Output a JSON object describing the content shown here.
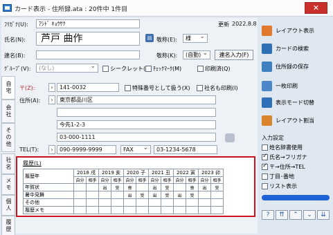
{
  "window": {
    "title": "カード表示 - 住所録.ata : 20件中 1件目",
    "close_glyph": "✕"
  },
  "header": {
    "update_label": "更新",
    "update_value": "2022.8.8"
  },
  "name": {
    "furigana_label": "ﾌﾘｶﾞﾅ(U):",
    "furigana_value": "ｱｼﾄﾞ ｷｮｳｻｸ",
    "name_label": "氏名(N):",
    "name_value": "芦戸 曲作",
    "honorific_label": "敬称(E):",
    "honorific_value": "様",
    "joint_label": "連名(B):",
    "joint_value": "",
    "joint_honorific_label": "敬称(K):",
    "joint_honorific_value": "(自動)",
    "joint_input_button": "連名入力(F)",
    "group_label": "ｸﾞﾙｰﾌﾟ(V):",
    "group_value": "(なし)",
    "seal_label": "シークレット(O)",
    "check_mark_label": "ﾁｪｯｸﾏｰｸ(M)",
    "print_label": "印刷済(Q)"
  },
  "side_tabs": [
    "自宅",
    "会社",
    "その他",
    "社名",
    "メモ",
    "個人",
    "履歴"
  ],
  "address": {
    "postal_label": "〒(Z):",
    "postal_value": "141-0032",
    "special_label": "特殊番号として扱う(X)",
    "company_print_label": "社名も印刷(I)",
    "address_label": "住所(A):",
    "address_line1": "東京都品川区",
    "address_line2": "",
    "address_line3": "今先1-2-3",
    "address_line4": "03-000-1111",
    "tel_label": "TEL(T):",
    "tel_value": "090-9999-9999",
    "fax_label": "FAX",
    "fax_value": "03-1234-5678"
  },
  "history": {
    "title": "履歴(L)",
    "year_header": "履歴年",
    "years": [
      "2018 戌",
      "2019 亥",
      "2020 子",
      "2021 丑",
      "2022 寅",
      "2023 卯"
    ],
    "sub_headers": [
      "自分",
      "相手"
    ],
    "rows": [
      {
        "label": "年賀状",
        "cells": [
          "",
          "",
          "出",
          "受",
          "喪",
          "",
          "出",
          "受",
          "",
          "喪",
          "出",
          "受"
        ]
      },
      {
        "label": "暑中見舞",
        "cells": [
          "",
          "",
          "",
          "",
          "出",
          "受",
          "出",
          "受",
          "出",
          "受",
          "",
          ""
        ]
      },
      {
        "label": "その他",
        "cells": [
          "",
          "",
          "",
          "",
          "",
          "",
          "",
          "",
          "",
          "",
          "",
          ""
        ]
      },
      {
        "label": "履歴メモ",
        "cells": [
          "",
          "",
          "",
          "",
          "",
          "",
          "",
          "",
          "",
          "",
          "",
          ""
        ]
      }
    ]
  },
  "right_panel": {
    "items": [
      {
        "label": "レイアウト表示",
        "icon": "layout-icon",
        "color": "#e07a2a"
      },
      {
        "label": "カードの検索",
        "icon": "search-card-icon",
        "color": "#2f6fb5"
      },
      {
        "label": "住所録の保存",
        "icon": "save-icon",
        "color": "#3d7fc0"
      },
      {
        "label": "一枚印刷",
        "icon": "printer-icon",
        "color": "#4c88c9"
      },
      {
        "label": "表示モード切替",
        "icon": "view-mode-icon",
        "color": "#2e6fb8"
      },
      {
        "label": "レイアウト割当",
        "icon": "layout-assign-icon",
        "color": "#d9832b"
      }
    ],
    "input_settings_label": "入力設定",
    "options": [
      {
        "label": "姓名辞書使用",
        "checked": false
      },
      {
        "label": "氏名→フリガナ",
        "checked": true
      },
      {
        "label": "〒→住所→TEL",
        "checked": true
      },
      {
        "label": "丁目･番地",
        "checked": false
      },
      {
        "label": "リスト表示",
        "checked": false
      }
    ],
    "nav_buttons": [
      "?",
      "⇈",
      "⌃",
      "⌄",
      "⇊"
    ]
  },
  "colors": {
    "highlight_border": "#d0121a",
    "progress": "#1e63d6"
  }
}
